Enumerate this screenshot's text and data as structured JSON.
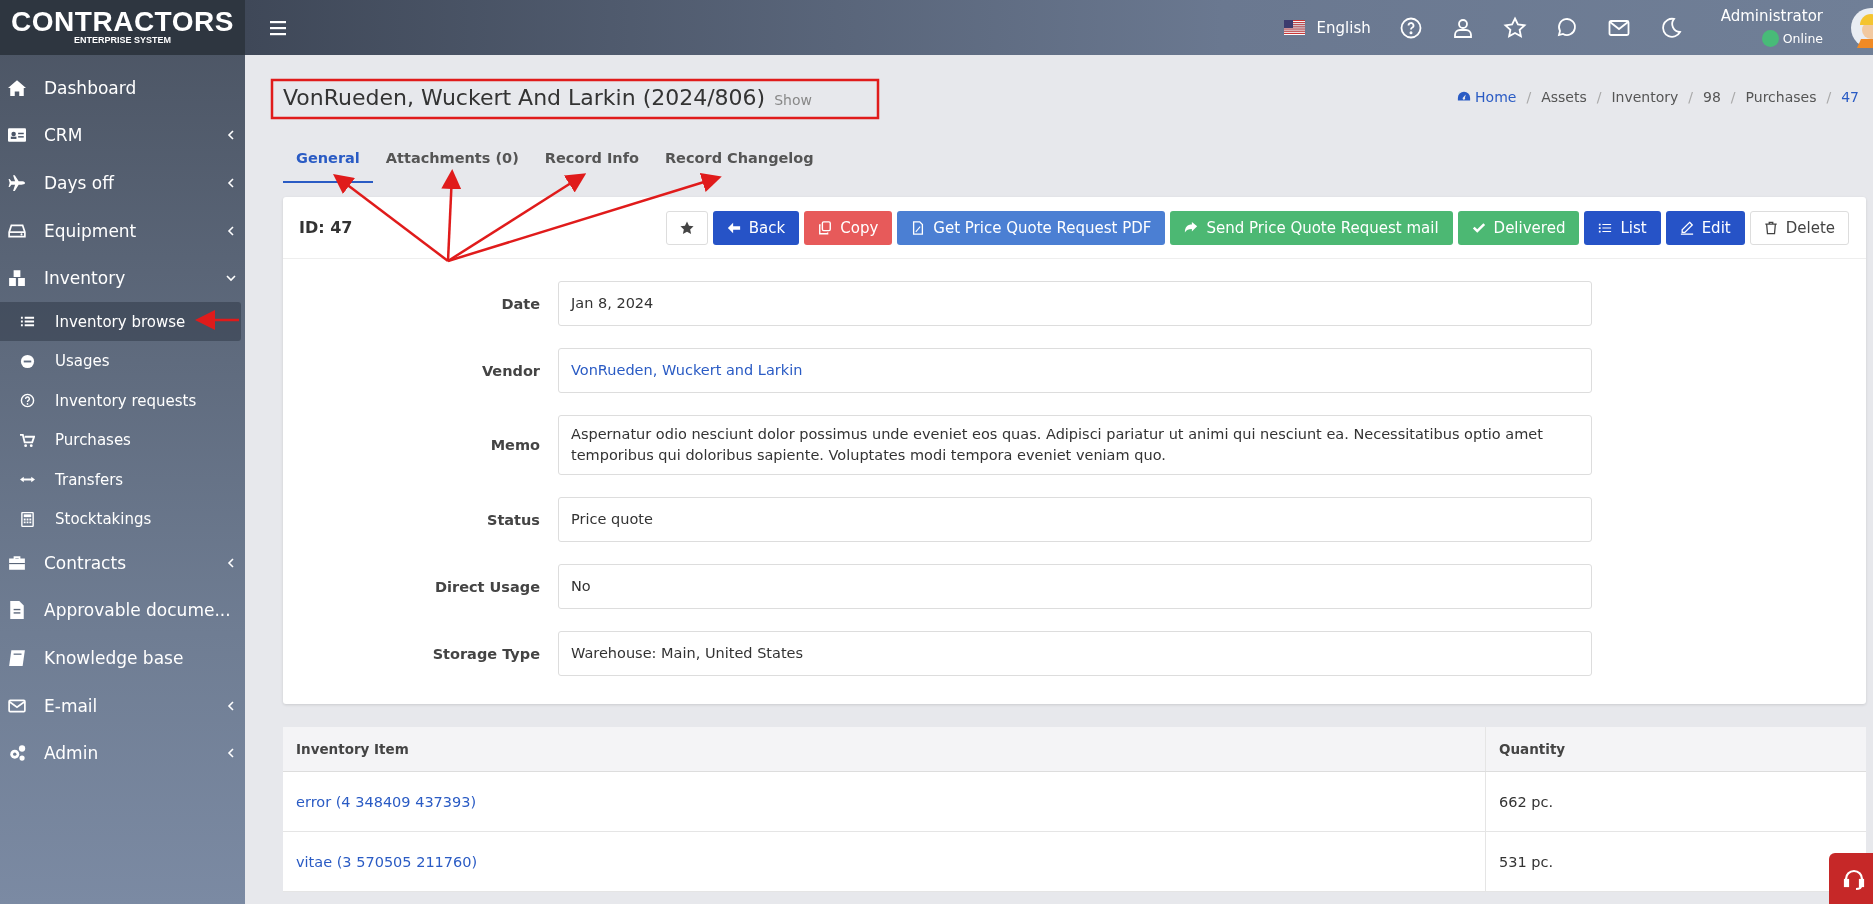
{
  "logo": {
    "title": "CONTRACTORS",
    "subtitle": "ENTERPRISE SYSTEM"
  },
  "topbar": {
    "language": "English",
    "user": {
      "name": "Administrator",
      "status": "Online"
    }
  },
  "sidebar": {
    "items": [
      {
        "label": "Dashboard"
      },
      {
        "label": "CRM",
        "expanded": false
      },
      {
        "label": "Days off",
        "expanded": false
      },
      {
        "label": "Equipment",
        "expanded": false
      },
      {
        "label": "Inventory",
        "expanded": true,
        "children": [
          {
            "label": "Inventory browse",
            "selected": true
          },
          {
            "label": "Usages",
            "selected": false
          },
          {
            "label": "Inventory requests",
            "selected": false
          },
          {
            "label": "Purchases",
            "selected": false
          },
          {
            "label": "Transfers",
            "selected": false
          },
          {
            "label": "Stocktakings",
            "selected": false
          }
        ]
      },
      {
        "label": "Contracts",
        "expanded": false
      },
      {
        "label": "Approvable docume..."
      },
      {
        "label": "Knowledge base"
      },
      {
        "label": "E-mail",
        "expanded": false
      },
      {
        "label": "Admin",
        "expanded": false
      }
    ]
  },
  "page": {
    "title": "VonRueden, Wuckert And Larkin (2024/806)",
    "subtitle": "Show"
  },
  "breadcrumb_separator": "/",
  "breadcrumb": [
    {
      "label": "Home",
      "kind": "link"
    },
    {
      "label": "Assets",
      "kind": "text"
    },
    {
      "label": "Inventory",
      "kind": "text"
    },
    {
      "label": "98",
      "kind": "text"
    },
    {
      "label": "Purchases",
      "kind": "text"
    },
    {
      "label": "47",
      "kind": "link"
    }
  ],
  "tabs": [
    {
      "label": "General",
      "selected": true
    },
    {
      "label": "Attachments (0)",
      "selected": false
    },
    {
      "label": "Record Info",
      "selected": false
    },
    {
      "label": "Record Changelog",
      "selected": false
    }
  ],
  "record": {
    "id_label": "ID: 47",
    "actions": [
      {
        "kind": "light"
      },
      {
        "label": "Back",
        "kind": "primary"
      },
      {
        "label": "Copy",
        "kind": "danger"
      },
      {
        "label": "Get Price Quote Request PDF",
        "kind": "info"
      },
      {
        "label": "Send Price Quote Request mail",
        "kind": "success"
      },
      {
        "label": "Delivered",
        "kind": "success"
      },
      {
        "label": "List",
        "kind": "primary"
      },
      {
        "label": "Edit",
        "kind": "primary"
      },
      {
        "label": "Delete",
        "kind": "light"
      }
    ],
    "fields": [
      {
        "label": "Date",
        "value": "Jan 8, 2024",
        "kind": "text"
      },
      {
        "label": "Vendor",
        "value": "VonRueden, Wuckert and Larkin",
        "kind": "link"
      },
      {
        "label": "Memo",
        "value": "Aspernatur odio nesciunt dolor possimus unde eveniet eos quas. Adipisci pariatur ut animi qui nesciunt ea. Necessitatibus optio amet temporibus qui doloribus sapiente. Voluptates modi tempora eveniet veniam quo.",
        "kind": "text"
      },
      {
        "label": "Status",
        "value": "Price quote",
        "kind": "text"
      },
      {
        "label": "Direct Usage",
        "value": "No",
        "kind": "text"
      },
      {
        "label": "Storage Type",
        "value": "Warehouse: Main, United States",
        "kind": "text"
      }
    ]
  },
  "table": {
    "columns": [
      "Inventory Item",
      "Quantity"
    ],
    "rows": [
      [
        "error (4 348409 437393)",
        "662 pc."
      ],
      [
        "vitae (3 570505 211760)",
        "531 pc."
      ]
    ]
  }
}
